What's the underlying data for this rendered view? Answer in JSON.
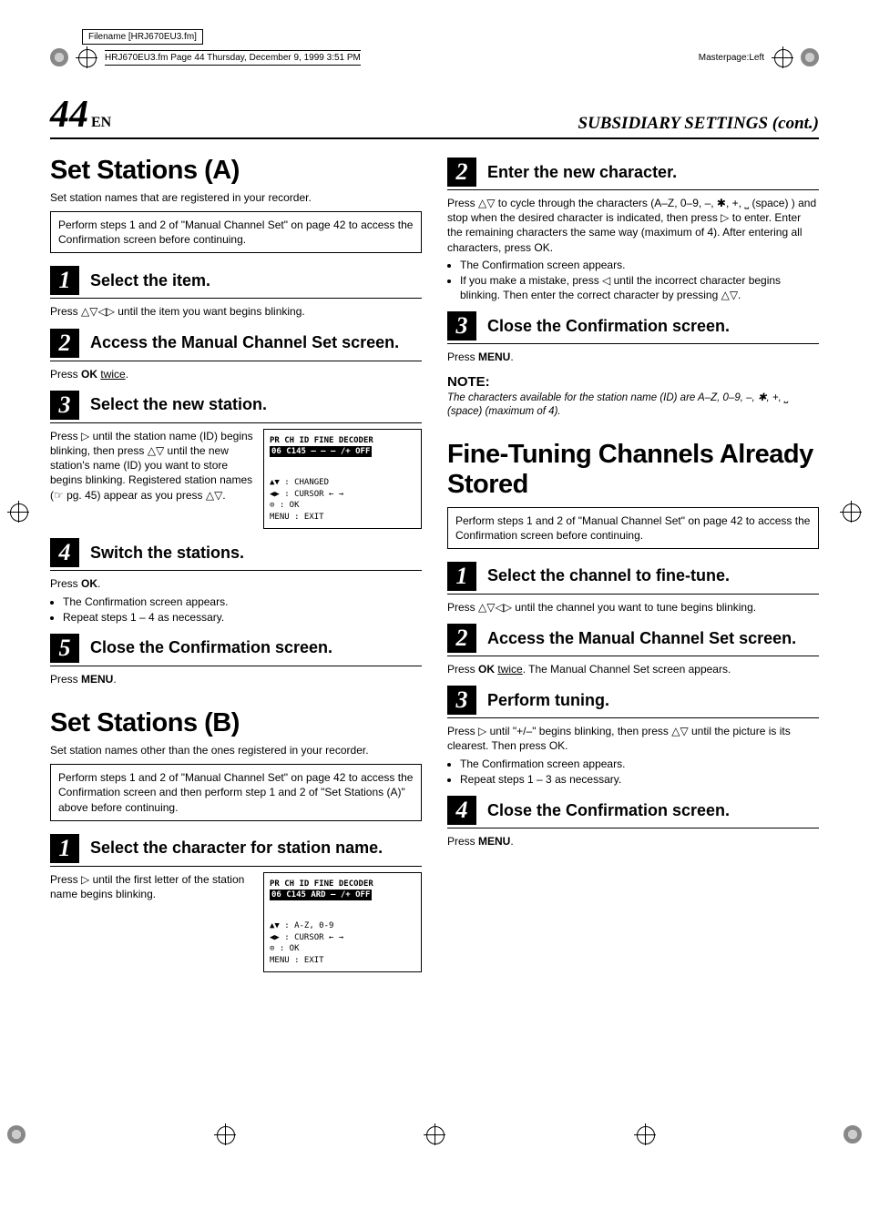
{
  "meta": {
    "filename_label": "Filename [HRJ670EU3.fm]",
    "runheader": "HRJ670EU3.fm  Page 44  Thursday, December 9, 1999  3:51 PM",
    "masterpage": "Masterpage:Left"
  },
  "header": {
    "page_number": "44",
    "page_suffix": "EN",
    "running_title": "SUBSIDIARY SETTINGS (cont.)"
  },
  "left": {
    "sectionA": {
      "title": "Set Stations (A)",
      "intro": "Set station names that are registered in your recorder.",
      "box": "Perform steps 1 and 2 of \"Manual Channel Set\" on page 42 to access the Confirmation screen before continuing.",
      "steps": [
        {
          "n": "1",
          "title": "Select the item.",
          "body": "Press △▽◁▷ until the item you want begins blinking."
        },
        {
          "n": "2",
          "title": "Access the Manual Channel Set screen.",
          "body_pre": "Press ",
          "body_bold": "OK",
          "body_post": " ",
          "body_underline": "twice",
          "body_end": "."
        },
        {
          "n": "3",
          "title": "Select the new station.",
          "body": "Press ▷ until the station name (ID) begins blinking, then press △▽ until the new station's name (ID) you want to store begins blinking. Registered station names (☞ pg. 45) appear as you press △▽.",
          "screen": {
            "header": "PR   CH   ID  FINE  DECODER",
            "row": "06  C145  — —  – /+    OFF",
            "legend1": "▲▼ : CHANGED",
            "legend2": "◀▶ : CURSOR ← →",
            "legend3": "⊙  : OK",
            "legend4": "MENU : EXIT"
          }
        },
        {
          "n": "4",
          "title": "Switch the stations.",
          "body_pre": "Press ",
          "body_bold": "OK",
          "body_post": ".",
          "bullets": [
            "The Confirmation screen appears.",
            "Repeat steps 1 – 4 as necessary."
          ]
        },
        {
          "n": "5",
          "title": "Close the Confirmation screen.",
          "body_pre": "Press ",
          "body_bold": "MENU",
          "body_post": "."
        }
      ]
    },
    "sectionB": {
      "title": "Set Stations (B)",
      "intro": "Set station names other than the ones registered in your recorder.",
      "box": "Perform steps 1 and 2 of \"Manual Channel Set\" on page 42 to access the Confirmation screen and then perform step 1 and 2 of \"Set Stations (A)\" above before continuing.",
      "steps": [
        {
          "n": "1",
          "title": "Select the character for station name.",
          "body": "Press ▷ until the first letter of the station name begins blinking.",
          "screen": {
            "header": "PR   CH   ID   FINE  DECODER",
            "row": "06  C145  ARD   – /+   OFF",
            "legend1": "▲▼ : A-Z, 0-9",
            "legend2": "◀▶ : CURSOR ← →",
            "legend3": "⊙  : OK",
            "legend4": "MENU : EXIT"
          }
        }
      ]
    }
  },
  "right": {
    "cont_steps": [
      {
        "n": "2",
        "title": "Enter the new character.",
        "body": "Press △▽ to cycle through the characters (A–Z, 0–9, –, ✱, +, ⎵ (space) ) and stop when the desired character is indicated, then press ▷ to enter. Enter the remaining characters the same way (maximum of 4). After entering all characters, press OK.",
        "bullets": [
          "The Confirmation screen appears.",
          "If you make a mistake, press ◁ until the incorrect character begins blinking. Then enter the correct character by pressing △▽."
        ]
      },
      {
        "n": "3",
        "title": "Close the Confirmation screen.",
        "body_pre": "Press ",
        "body_bold": "MENU",
        "body_post": "."
      }
    ],
    "note": {
      "head": "NOTE:",
      "body": "The characters available for the station name (ID) are A–Z, 0–9, –, ✱, +, ⎵ (space) (maximum of 4)."
    },
    "fine": {
      "title": "Fine-Tuning Channels Already Stored",
      "box": "Perform steps 1 and 2 of \"Manual Channel Set\" on page 42 to access the Confirmation screen before continuing.",
      "steps": [
        {
          "n": "1",
          "title": "Select the channel to fine-tune.",
          "body": "Press △▽◁▷ until the channel you want to tune begins blinking."
        },
        {
          "n": "2",
          "title": "Access the Manual Channel Set screen.",
          "body_pre": "Press ",
          "body_bold": "OK",
          "body_post": " ",
          "body_underline": "twice",
          "body_end": ". The Manual Channel Set screen appears."
        },
        {
          "n": "3",
          "title": "Perform tuning.",
          "body": "Press ▷ until \"+/–\" begins blinking, then press △▽ until the picture is its clearest. Then press OK.",
          "bullets": [
            "The Confirmation screen appears.",
            "Repeat steps 1 – 3 as necessary."
          ]
        },
        {
          "n": "4",
          "title": "Close the Confirmation screen.",
          "body_pre": "Press ",
          "body_bold": "MENU",
          "body_post": "."
        }
      ]
    }
  }
}
